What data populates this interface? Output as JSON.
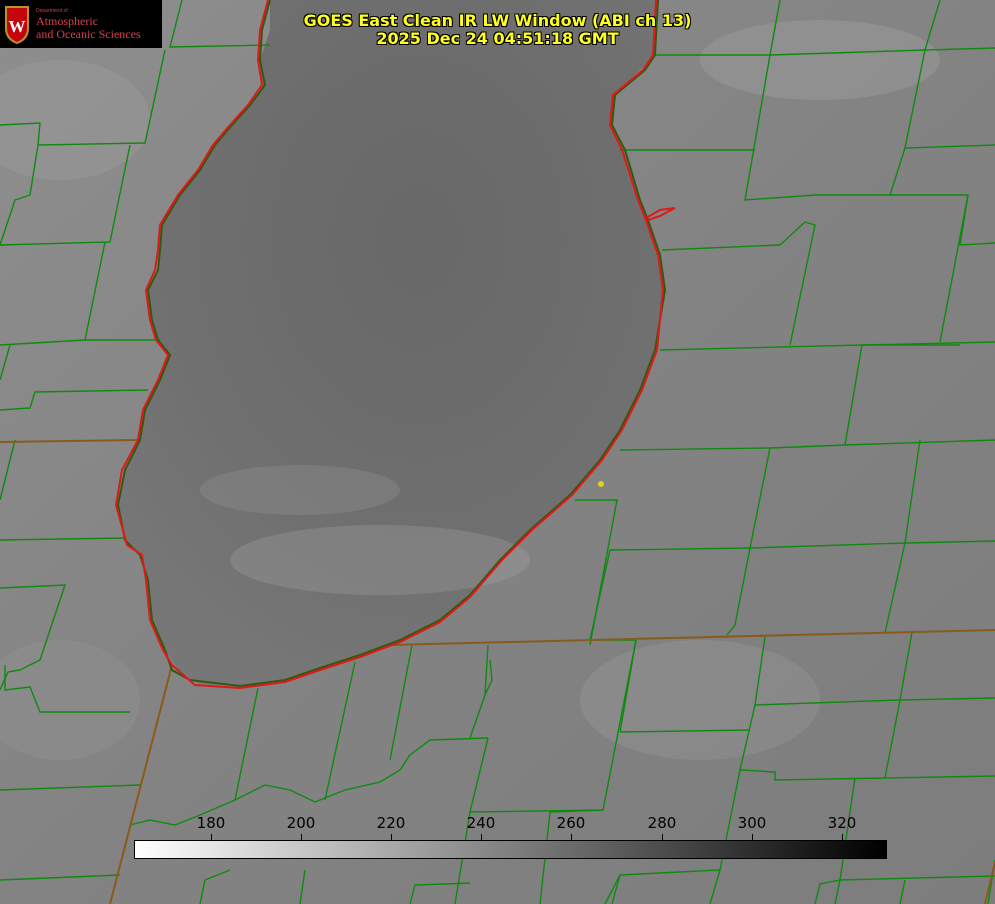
{
  "title": {
    "line1": "GOES East Clean IR LW Window (ABI ch 13)",
    "line2": "2025 Dec 24 04:51:18 GMT"
  },
  "logo": {
    "line0": "Department of",
    "line1": "Atmospheric",
    "line2": "and Oceanic Sciences",
    "crest_icon": "uw-crest-icon"
  },
  "colorbar": {
    "min": 163,
    "max": 330,
    "tick_values": [
      180,
      200,
      220,
      240,
      260,
      280,
      300,
      320
    ],
    "tick_labels": [
      "180",
      "200",
      "220",
      "240",
      "260",
      "280",
      "300",
      "320"
    ],
    "start_color": "#ffffff",
    "end_color": "#000000"
  },
  "colors": {
    "county_lines": "#0f8a0f",
    "state_lines": "#8a5a1a",
    "lake_shore": "#e01818",
    "marker": "#e0d020",
    "title": "#ffff22",
    "logo_text": "#d23a47"
  },
  "map": {
    "feature_names": [
      "lake-shoreline",
      "county-boundary",
      "state-boundary",
      "location-marker"
    ]
  }
}
